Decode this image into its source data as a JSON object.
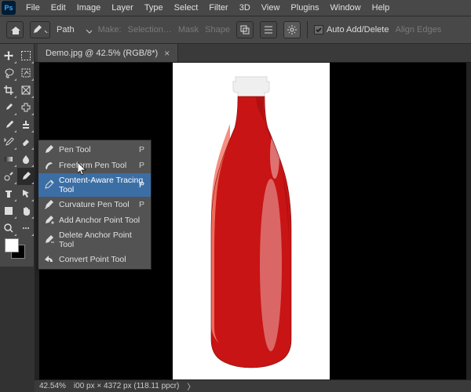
{
  "app": {
    "logo_text": "Ps"
  },
  "menu": {
    "items": [
      "File",
      "Edit",
      "Image",
      "Layer",
      "Type",
      "Select",
      "Filter",
      "3D",
      "View",
      "Plugins",
      "Window",
      "Help"
    ]
  },
  "options": {
    "mode_label": "Path",
    "make_label": "Make:",
    "selection_label": "Selection…",
    "mask_label": "Mask",
    "shape_label": "Shape",
    "auto_add_delete_label": "Auto Add/Delete",
    "auto_add_delete_checked": true,
    "align_edges_label": "Align Edges"
  },
  "document": {
    "tab_title": "Demo.jpg @ 42.5% (RGB/8*)"
  },
  "tools": {
    "grid": [
      {
        "name": "move-tool",
        "icon": "move"
      },
      {
        "name": "marquee-tool",
        "icon": "marquee"
      },
      {
        "name": "lasso-tool",
        "icon": "lasso"
      },
      {
        "name": "object-select-tool",
        "icon": "objsel"
      },
      {
        "name": "crop-tool",
        "icon": "crop"
      },
      {
        "name": "frame-tool",
        "icon": "frame"
      },
      {
        "name": "eyedropper-tool",
        "icon": "eyedrop"
      },
      {
        "name": "healing-brush-tool",
        "icon": "heal"
      },
      {
        "name": "brush-tool",
        "icon": "brush"
      },
      {
        "name": "clone-stamp-tool",
        "icon": "stamp"
      },
      {
        "name": "history-brush-tool",
        "icon": "histbrush"
      },
      {
        "name": "eraser-tool",
        "icon": "eraser"
      },
      {
        "name": "gradient-tool",
        "icon": "gradient"
      },
      {
        "name": "blur-tool",
        "icon": "blur"
      },
      {
        "name": "dodge-tool",
        "icon": "dodge"
      },
      {
        "name": "pen-tool",
        "icon": "pen",
        "selected": true
      },
      {
        "name": "type-tool",
        "icon": "type"
      },
      {
        "name": "path-select-tool",
        "icon": "pathsel"
      },
      {
        "name": "shape-tool",
        "icon": "shape"
      },
      {
        "name": "hand-tool",
        "icon": "hand"
      },
      {
        "name": "zoom-tool",
        "icon": "zoom"
      },
      {
        "name": "edit-toolbar",
        "icon": "dots"
      }
    ]
  },
  "flyout": {
    "items": [
      {
        "label": "Pen Tool",
        "shortcut": "P",
        "icon": "pen"
      },
      {
        "label": "Freeform Pen Tool",
        "shortcut": "P",
        "icon": "freepen"
      },
      {
        "label": "Content-Aware Tracing Tool",
        "shortcut": "P",
        "icon": "catrace",
        "highlight": true
      },
      {
        "label": "Curvature Pen Tool",
        "shortcut": "P",
        "icon": "curvpen"
      },
      {
        "label": "Add Anchor Point Tool",
        "shortcut": "",
        "icon": "addanchor"
      },
      {
        "label": "Delete Anchor Point Tool",
        "shortcut": "",
        "icon": "delanchor"
      },
      {
        "label": "Convert Point Tool",
        "shortcut": "",
        "icon": "convert"
      }
    ]
  },
  "status": {
    "zoom": "42.54%",
    "dims": "i00 px × 4372 px (118.11 ppcr)"
  },
  "colors": {
    "bottle_red": "#c81414",
    "bottle_highlight": "#f37a6a",
    "cap_white": "#efefef"
  }
}
